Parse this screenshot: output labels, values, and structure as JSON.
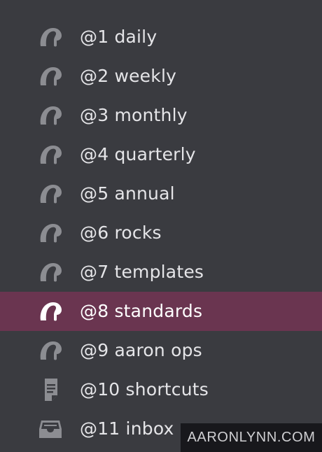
{
  "sidebar": {
    "items": [
      {
        "label": "@1 daily",
        "icon": "omnifocus-perspective-icon",
        "selected": false
      },
      {
        "label": "@2 weekly",
        "icon": "omnifocus-perspective-icon",
        "selected": false
      },
      {
        "label": "@3 monthly",
        "icon": "omnifocus-perspective-icon",
        "selected": false
      },
      {
        "label": "@4 quarterly",
        "icon": "omnifocus-perspective-icon",
        "selected": false
      },
      {
        "label": "@5 annual",
        "icon": "omnifocus-perspective-icon",
        "selected": false
      },
      {
        "label": "@6 rocks",
        "icon": "omnifocus-perspective-icon",
        "selected": false
      },
      {
        "label": "@7 templates",
        "icon": "omnifocus-perspective-icon",
        "selected": false
      },
      {
        "label": "@8 standards",
        "icon": "omnifocus-perspective-icon",
        "selected": true
      },
      {
        "label": "@9 aaron ops",
        "icon": "omnifocus-perspective-icon",
        "selected": false
      },
      {
        "label": "@10 shortcuts",
        "icon": "document-icon",
        "selected": false
      },
      {
        "label": "@11 inbox",
        "icon": "inbox-tray-icon",
        "selected": false
      }
    ]
  },
  "watermark": {
    "text": "AARONLYNN.COM"
  },
  "colors": {
    "background": "#3a3b40",
    "selected_row": "#6a3550",
    "icon": "#8c8d92",
    "icon_selected": "#ffffff",
    "text": "#e5e5e8"
  }
}
